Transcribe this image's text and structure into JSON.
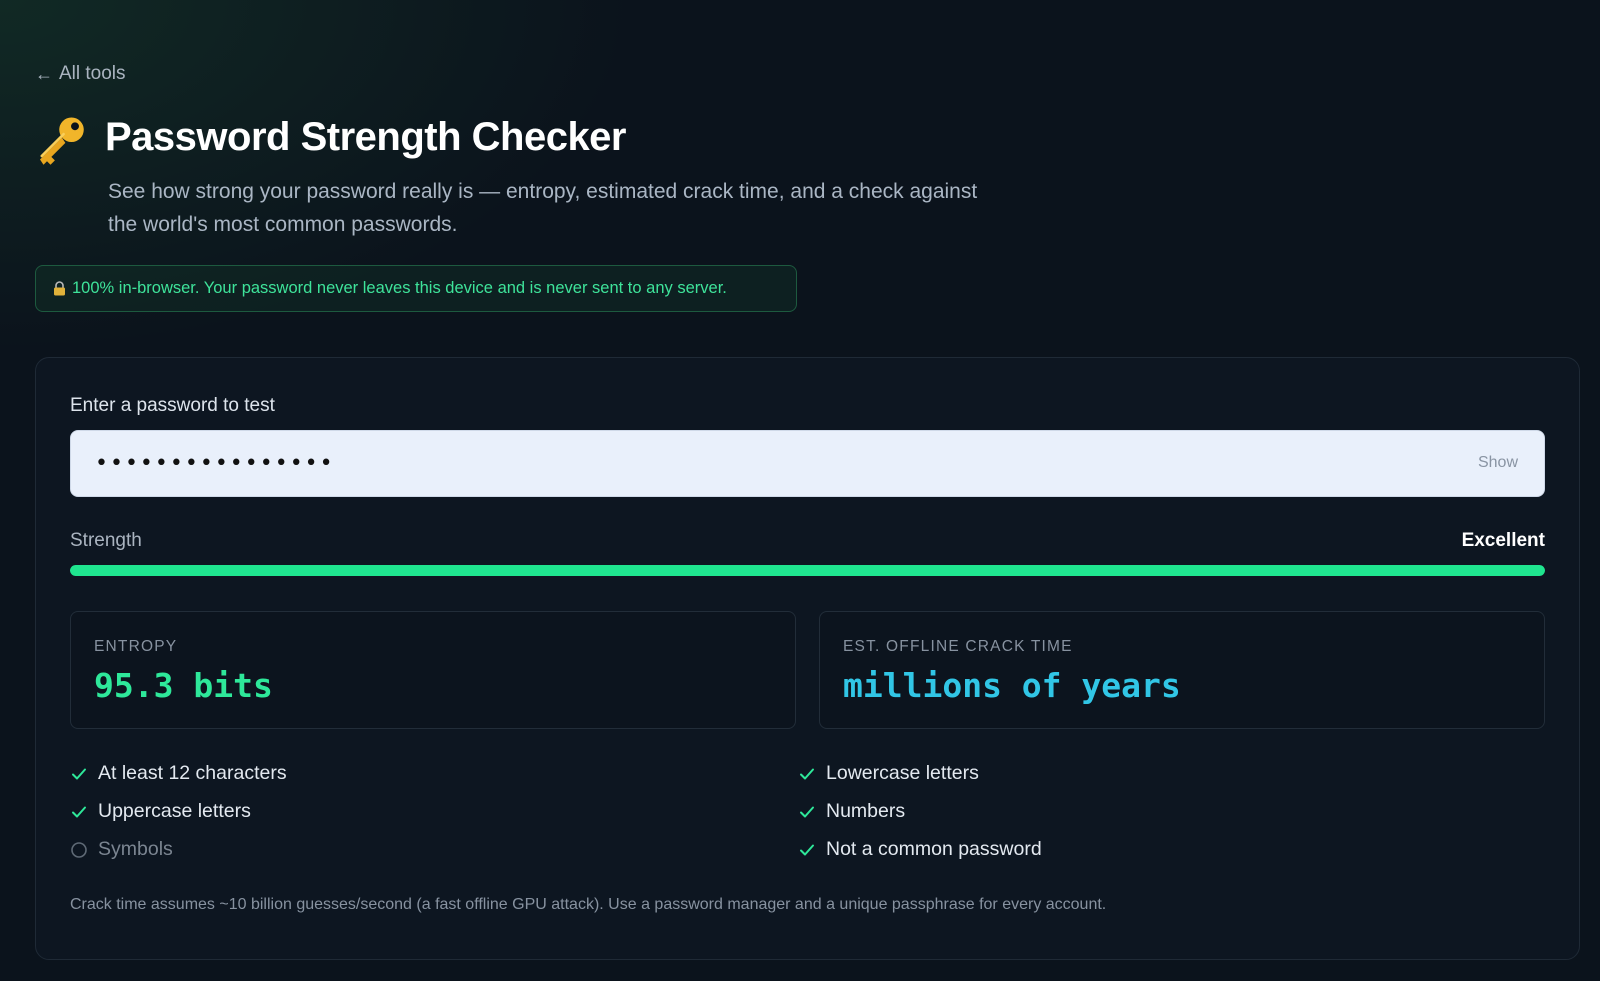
{
  "nav": {
    "back_label": "All tools"
  },
  "header": {
    "icon": "key-icon",
    "title": "Password Strength Checker",
    "subtitle_line1": "See how strong your password really is — entropy, estimated crack time, and a check against",
    "subtitle_line2": "the world's most common passwords."
  },
  "privacy": {
    "icon": "lock-icon",
    "text": "100% in-browser. Your password never leaves this device and is never sent to any server."
  },
  "form": {
    "label": "Enter a password to test",
    "password_value": "••••••••••••••••",
    "show_label": "Show"
  },
  "strength": {
    "label": "Strength",
    "value": "Excellent",
    "fill_fraction": 1.0,
    "color": "#1fe58f"
  },
  "stats": {
    "entropy_label": "ENTROPY",
    "entropy_value": "95.3 bits",
    "crack_label": "EST. OFFLINE CRACK TIME",
    "crack_value": "millions of years"
  },
  "checks": [
    {
      "label": "At least 12 characters",
      "passed": true
    },
    {
      "label": "Lowercase letters",
      "passed": true
    },
    {
      "label": "Uppercase letters",
      "passed": true
    },
    {
      "label": "Numbers",
      "passed": true
    },
    {
      "label": "Symbols",
      "passed": false
    },
    {
      "label": "Not a common password",
      "passed": true
    }
  ],
  "note": "Crack time assumes ~10 billion guesses/second (a fast offline GPU attack). Use a password manager and a unique passphrase for every account."
}
